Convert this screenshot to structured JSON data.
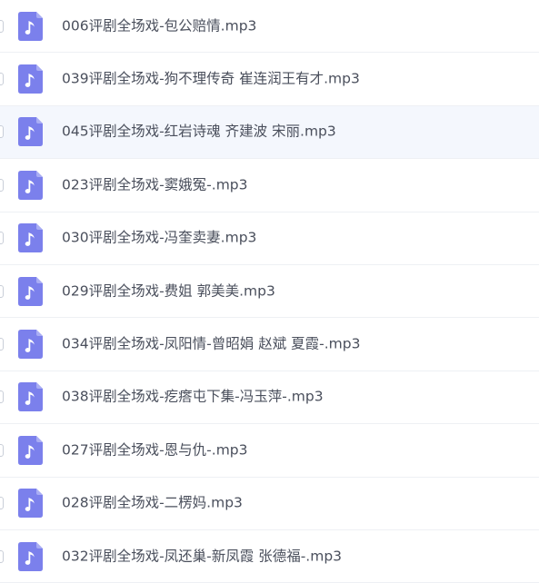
{
  "file_list": {
    "icon": "audio-file-icon",
    "accent_color": "#7b80ec",
    "highlight_color": "#f4f7fd",
    "files": [
      {
        "name": "006评剧全场戏-包公赔情.mp3"
      },
      {
        "name": "039评剧全场戏-狗不理传奇 崔连润王有才.mp3"
      },
      {
        "name": "045评剧全场戏-红岩诗魂 齐建波 宋丽.mp3",
        "highlighted": true
      },
      {
        "name": "023评剧全场戏-窦娥冤-.mp3"
      },
      {
        "name": "030评剧全场戏-冯奎卖妻.mp3"
      },
      {
        "name": "029评剧全场戏-费姐 郭美美.mp3"
      },
      {
        "name": "034评剧全场戏-凤阳情-曾昭娟 赵斌 夏霞-.mp3"
      },
      {
        "name": "038评剧全场戏-疙瘩屯下集-冯玉萍-.mp3"
      },
      {
        "name": "027评剧全场戏-恩与仇-.mp3"
      },
      {
        "name": "028评剧全场戏-二楞妈.mp3"
      },
      {
        "name": "032评剧全场戏-凤还巢-新凤霞 张德福-.mp3"
      }
    ]
  }
}
